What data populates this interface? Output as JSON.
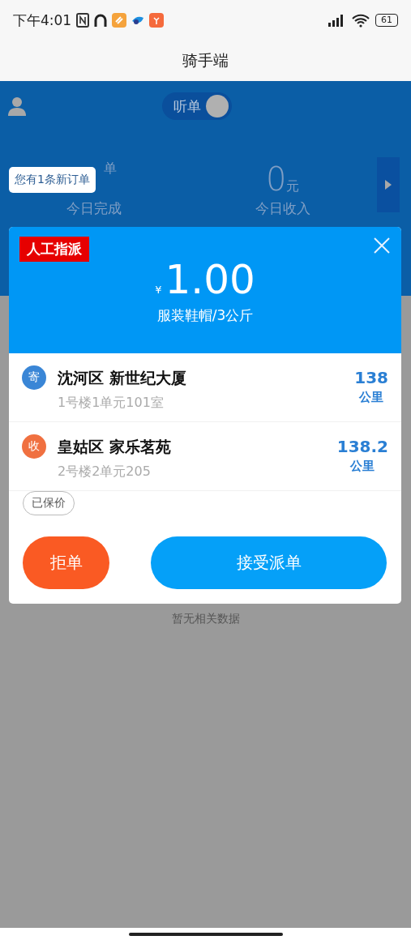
{
  "status_bar": {
    "time": "下午4:01",
    "battery": "61"
  },
  "title": "骑手端",
  "header": {
    "listen_toggle": {
      "label": "听单",
      "on": true
    },
    "stats": [
      {
        "unit": "单",
        "label": "今日完成"
      },
      {
        "value": "0",
        "unit": "元",
        "label": "今日收入"
      }
    ]
  },
  "toast": "您有1条新订单",
  "empty_text": "暂无相关数据",
  "order_dialog": {
    "tag": "人工指派",
    "currency": "¥",
    "price": "1.00",
    "goods": "服装鞋帽/3公斤",
    "stops": [
      {
        "kind": "send",
        "badge": "寄",
        "name": "沈河区 新世纪大厦",
        "detail": "1号楼1单元101室",
        "distance": "138",
        "unit": "公里"
      },
      {
        "kind": "receive",
        "badge": "收",
        "name": "皇姑区 家乐茗苑",
        "detail": "2号楼2单元205",
        "distance": "138.2",
        "unit": "公里"
      }
    ],
    "insured_tag": "已保价",
    "buttons": [
      {
        "kind": "reject",
        "label": "拒单"
      },
      {
        "kind": "accept",
        "label": "接受派单"
      }
    ]
  }
}
